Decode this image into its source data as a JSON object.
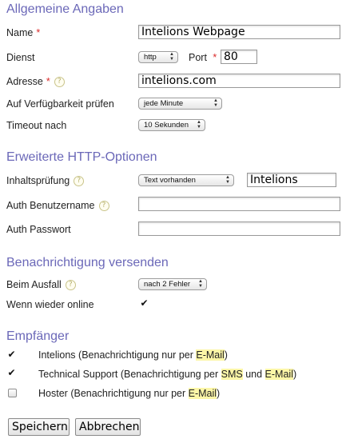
{
  "sections": {
    "general": "Allgemeine Angaben",
    "http": "Erweiterte HTTP-Optionen",
    "notify": "Benachrichtigung versenden",
    "recipients": "Empfänger"
  },
  "general": {
    "name_label": "Name",
    "name_value": "Intelions Webpage",
    "service_label": "Dienst",
    "service_value": "http",
    "port_label": "Port",
    "port_value": "80",
    "address_label": "Adresse",
    "address_value": "intelions.com",
    "availability_label": "Auf Verfügbarkeit prüfen",
    "availability_value": "jede Minute",
    "timeout_label": "Timeout nach",
    "timeout_value": "10 Sekunden"
  },
  "http": {
    "content_check_label": "Inhaltsprüfung",
    "content_check_mode": "Text vorhanden",
    "content_check_value": "Intelions",
    "auth_user_label": "Auth Benutzername",
    "auth_user_value": "",
    "auth_pass_label": "Auth Passwort",
    "auth_pass_value": ""
  },
  "notify": {
    "on_failure_label": "Beim Ausfall",
    "on_failure_value": "nach 2 Fehler",
    "when_online_label": "Wenn wieder online",
    "when_online_checked": true
  },
  "recipients": [
    {
      "name": "Intelions",
      "pre": "(Benachrichtigung nur per ",
      "hl1": "E-Mail",
      "mid": "",
      "hl2": "",
      "post": ")",
      "checked": true
    },
    {
      "name": "Technical Support",
      "pre": "(Benachrichtigung per ",
      "hl1": "SMS",
      "mid": " und ",
      "hl2": "E-Mail",
      "post": ")",
      "checked": true
    },
    {
      "name": "Hoster",
      "pre": "(Benachrichtigung nur per ",
      "hl1": "E-Mail",
      "mid": "",
      "hl2": "",
      "post": ")",
      "checked": false
    }
  ],
  "symbols": {
    "required": "*",
    "help": "?",
    "check": "✔",
    "arrow_up": "▲",
    "arrow_down": "▼"
  },
  "buttons": {
    "save": "Speichern",
    "cancel": "Abbrechen"
  },
  "colors": {
    "section_title": "#6b68b8",
    "required": "#d92a2a",
    "highlight": "#fcf6a7"
  }
}
